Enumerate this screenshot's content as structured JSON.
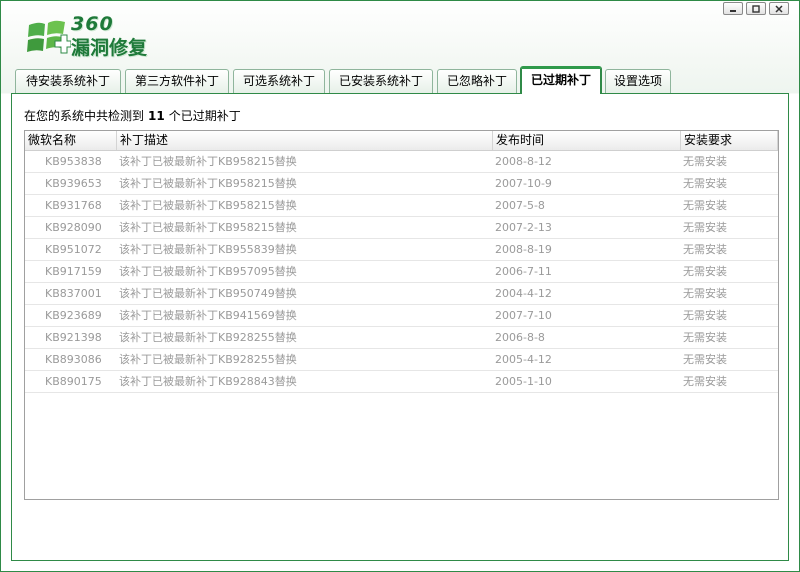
{
  "app": {
    "logo_brand": "360",
    "logo_title": "漏洞修复"
  },
  "tabs": [
    {
      "label": "待安装系统补丁",
      "active": false
    },
    {
      "label": "第三方软件补丁",
      "active": false
    },
    {
      "label": "可选系统补丁",
      "active": false
    },
    {
      "label": "已安装系统补丁",
      "active": false
    },
    {
      "label": "已忽略补丁",
      "active": false
    },
    {
      "label": "已过期补丁",
      "active": true
    },
    {
      "label": "设置选项",
      "active": false
    }
  ],
  "summary": {
    "prefix": "在您的系统中共检测到",
    "count": "11",
    "suffix": "个已过期补丁"
  },
  "table": {
    "columns": [
      "微软名称",
      "补丁描述",
      "发布时间",
      "安装要求"
    ],
    "rows": [
      [
        "KB953838",
        "该补丁已被最新补丁KB958215替换",
        "2008-8-12",
        "无需安装"
      ],
      [
        "KB939653",
        "该补丁已被最新补丁KB958215替换",
        "2007-10-9",
        "无需安装"
      ],
      [
        "KB931768",
        "该补丁已被最新补丁KB958215替换",
        "2007-5-8",
        "无需安装"
      ],
      [
        "KB928090",
        "该补丁已被最新补丁KB958215替换",
        "2007-2-13",
        "无需安装"
      ],
      [
        "KB951072",
        "该补丁已被最新补丁KB955839替换",
        "2008-8-19",
        "无需安装"
      ],
      [
        "KB917159",
        "该补丁已被最新补丁KB957095替换",
        "2006-7-11",
        "无需安装"
      ],
      [
        "KB837001",
        "该补丁已被最新补丁KB950749替换",
        "2004-4-12",
        "无需安装"
      ],
      [
        "KB923689",
        "该补丁已被最新补丁KB941569替换",
        "2007-7-10",
        "无需安装"
      ],
      [
        "KB921398",
        "该补丁已被最新补丁KB928255替换",
        "2006-8-8",
        "无需安装"
      ],
      [
        "KB893086",
        "该补丁已被最新补丁KB928255替换",
        "2005-4-12",
        "无需安装"
      ],
      [
        "KB890175",
        "该补丁已被最新补丁KB928843替换",
        "2005-1-10",
        "无需安装"
      ]
    ]
  },
  "colors": {
    "accent": "#2f8a47",
    "row_text": "#9a9a9a"
  }
}
